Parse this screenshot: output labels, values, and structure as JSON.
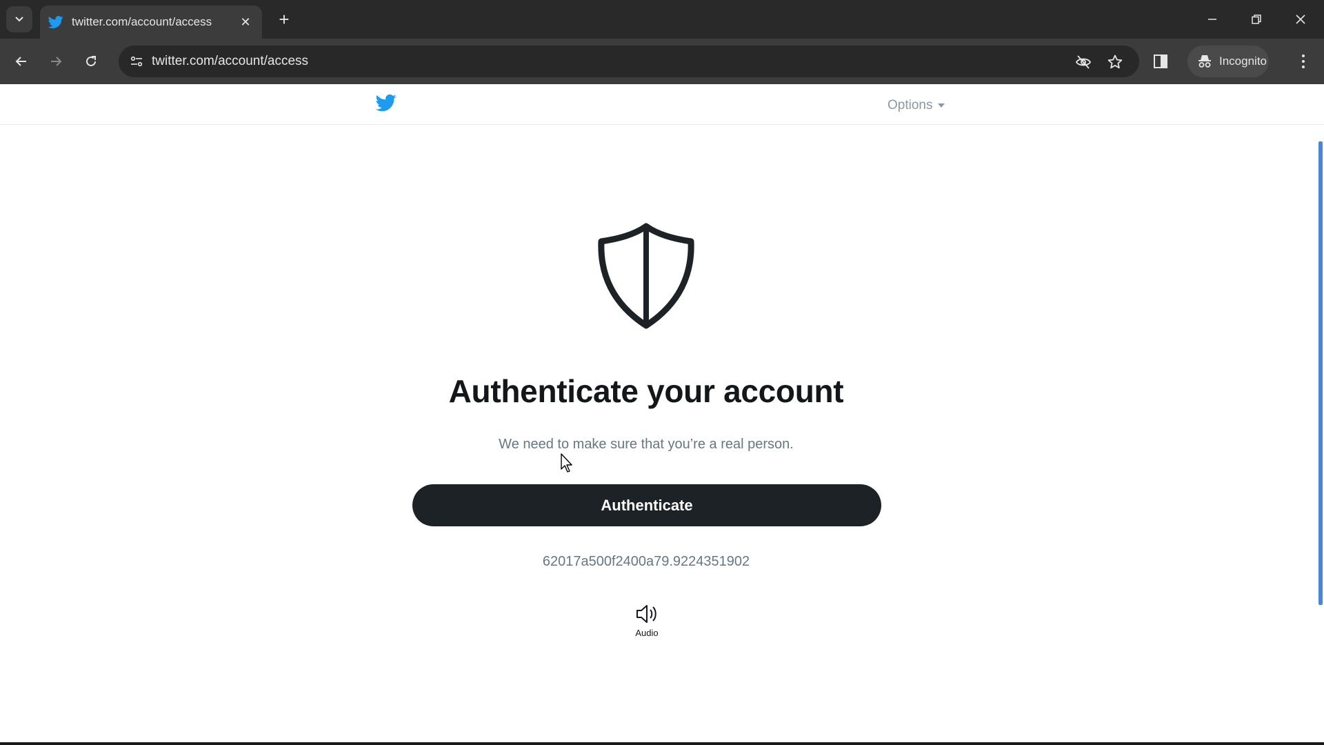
{
  "browser": {
    "tab": {
      "title": "twitter.com/account/access",
      "favicon": "twitter-bird-icon"
    },
    "tab_list_icon": "chevron-down-icon",
    "new_tab_icon": "plus-icon",
    "address_bar": {
      "url": "twitter.com/account/access"
    },
    "incognito_label": "Incognito",
    "window_controls": [
      "minimize",
      "restore",
      "close"
    ]
  },
  "site_header": {
    "logo": "twitter-bird-icon",
    "options_label": "Options"
  },
  "main": {
    "icon": "shield-icon",
    "title": "Authenticate your account",
    "subtitle": "We need to make sure that you’re a real person.",
    "button_label": "Authenticate",
    "request_id": "62017a500f2400a79.9224351902",
    "audio_label": "Audio"
  },
  "colors": {
    "brand_blue": "#1d9bf0",
    "button_bg": "#1d2226",
    "muted_text": "#657786"
  }
}
